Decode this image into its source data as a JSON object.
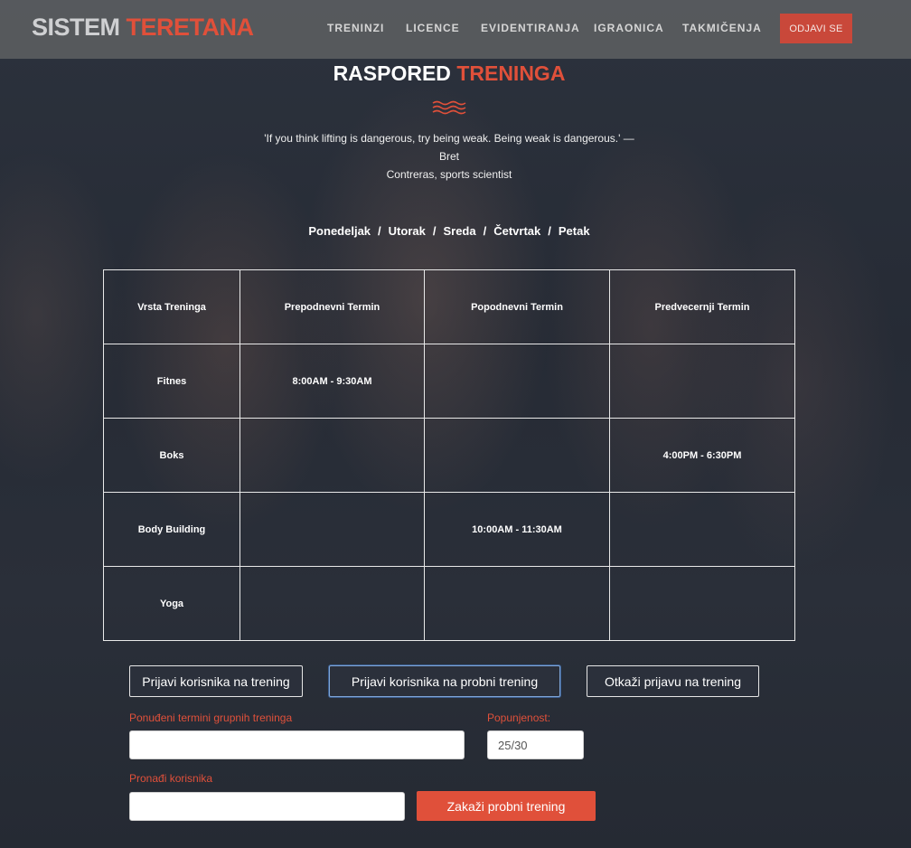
{
  "brand": {
    "part1": "SISTEM",
    "part2": "TERETANA"
  },
  "nav": {
    "items": [
      "TRENINZI",
      "LICENCE",
      "EVIDENTIRANJA",
      "IGRAONICA",
      "TAKMIČENJA"
    ],
    "logout": "ODJAVI SE"
  },
  "heading": {
    "part1": "RASPORED",
    "part2": "TRENINGA"
  },
  "quote": {
    "line1": "'If you think lifting is dangerous, try being weak. Being weak is dangerous.' — Bret",
    "line2": "Contreras, sports scientist"
  },
  "days": [
    "Ponedeljak",
    "Utorak",
    "Sreda",
    "Četvrtak",
    "Petak"
  ],
  "schedule": {
    "headers": [
      "Vrsta Treninga",
      "Prepodnevni Termin",
      "Popodnevni Termin",
      "Predvecernji Termin"
    ],
    "rows": [
      [
        "Fitnes",
        "8:00AM - 9:30AM",
        "",
        ""
      ],
      [
        "Boks",
        "",
        "",
        "4:00PM - 6:30PM"
      ],
      [
        "Body Building",
        "",
        "10:00AM - 11:30AM",
        ""
      ],
      [
        "Yoga",
        "",
        "",
        ""
      ]
    ]
  },
  "actions": {
    "enroll": "Prijavi korisnika na trening",
    "trial": "Prijavi korisnika na probni trening",
    "cancel": "Otkaži prijavu na trening"
  },
  "form": {
    "group_terms_label": "Ponuđeni termini grupnih treninga",
    "group_terms_value": "",
    "occupancy_label": "Popunjenost:",
    "occupancy_value": "25/30",
    "find_user_label": "Pronađi korisnika",
    "find_user_value": "",
    "schedule_trial_button": "Zakaži probni trening"
  },
  "colors": {
    "accent": "#e0503a",
    "topbar": "#5a5c60"
  }
}
